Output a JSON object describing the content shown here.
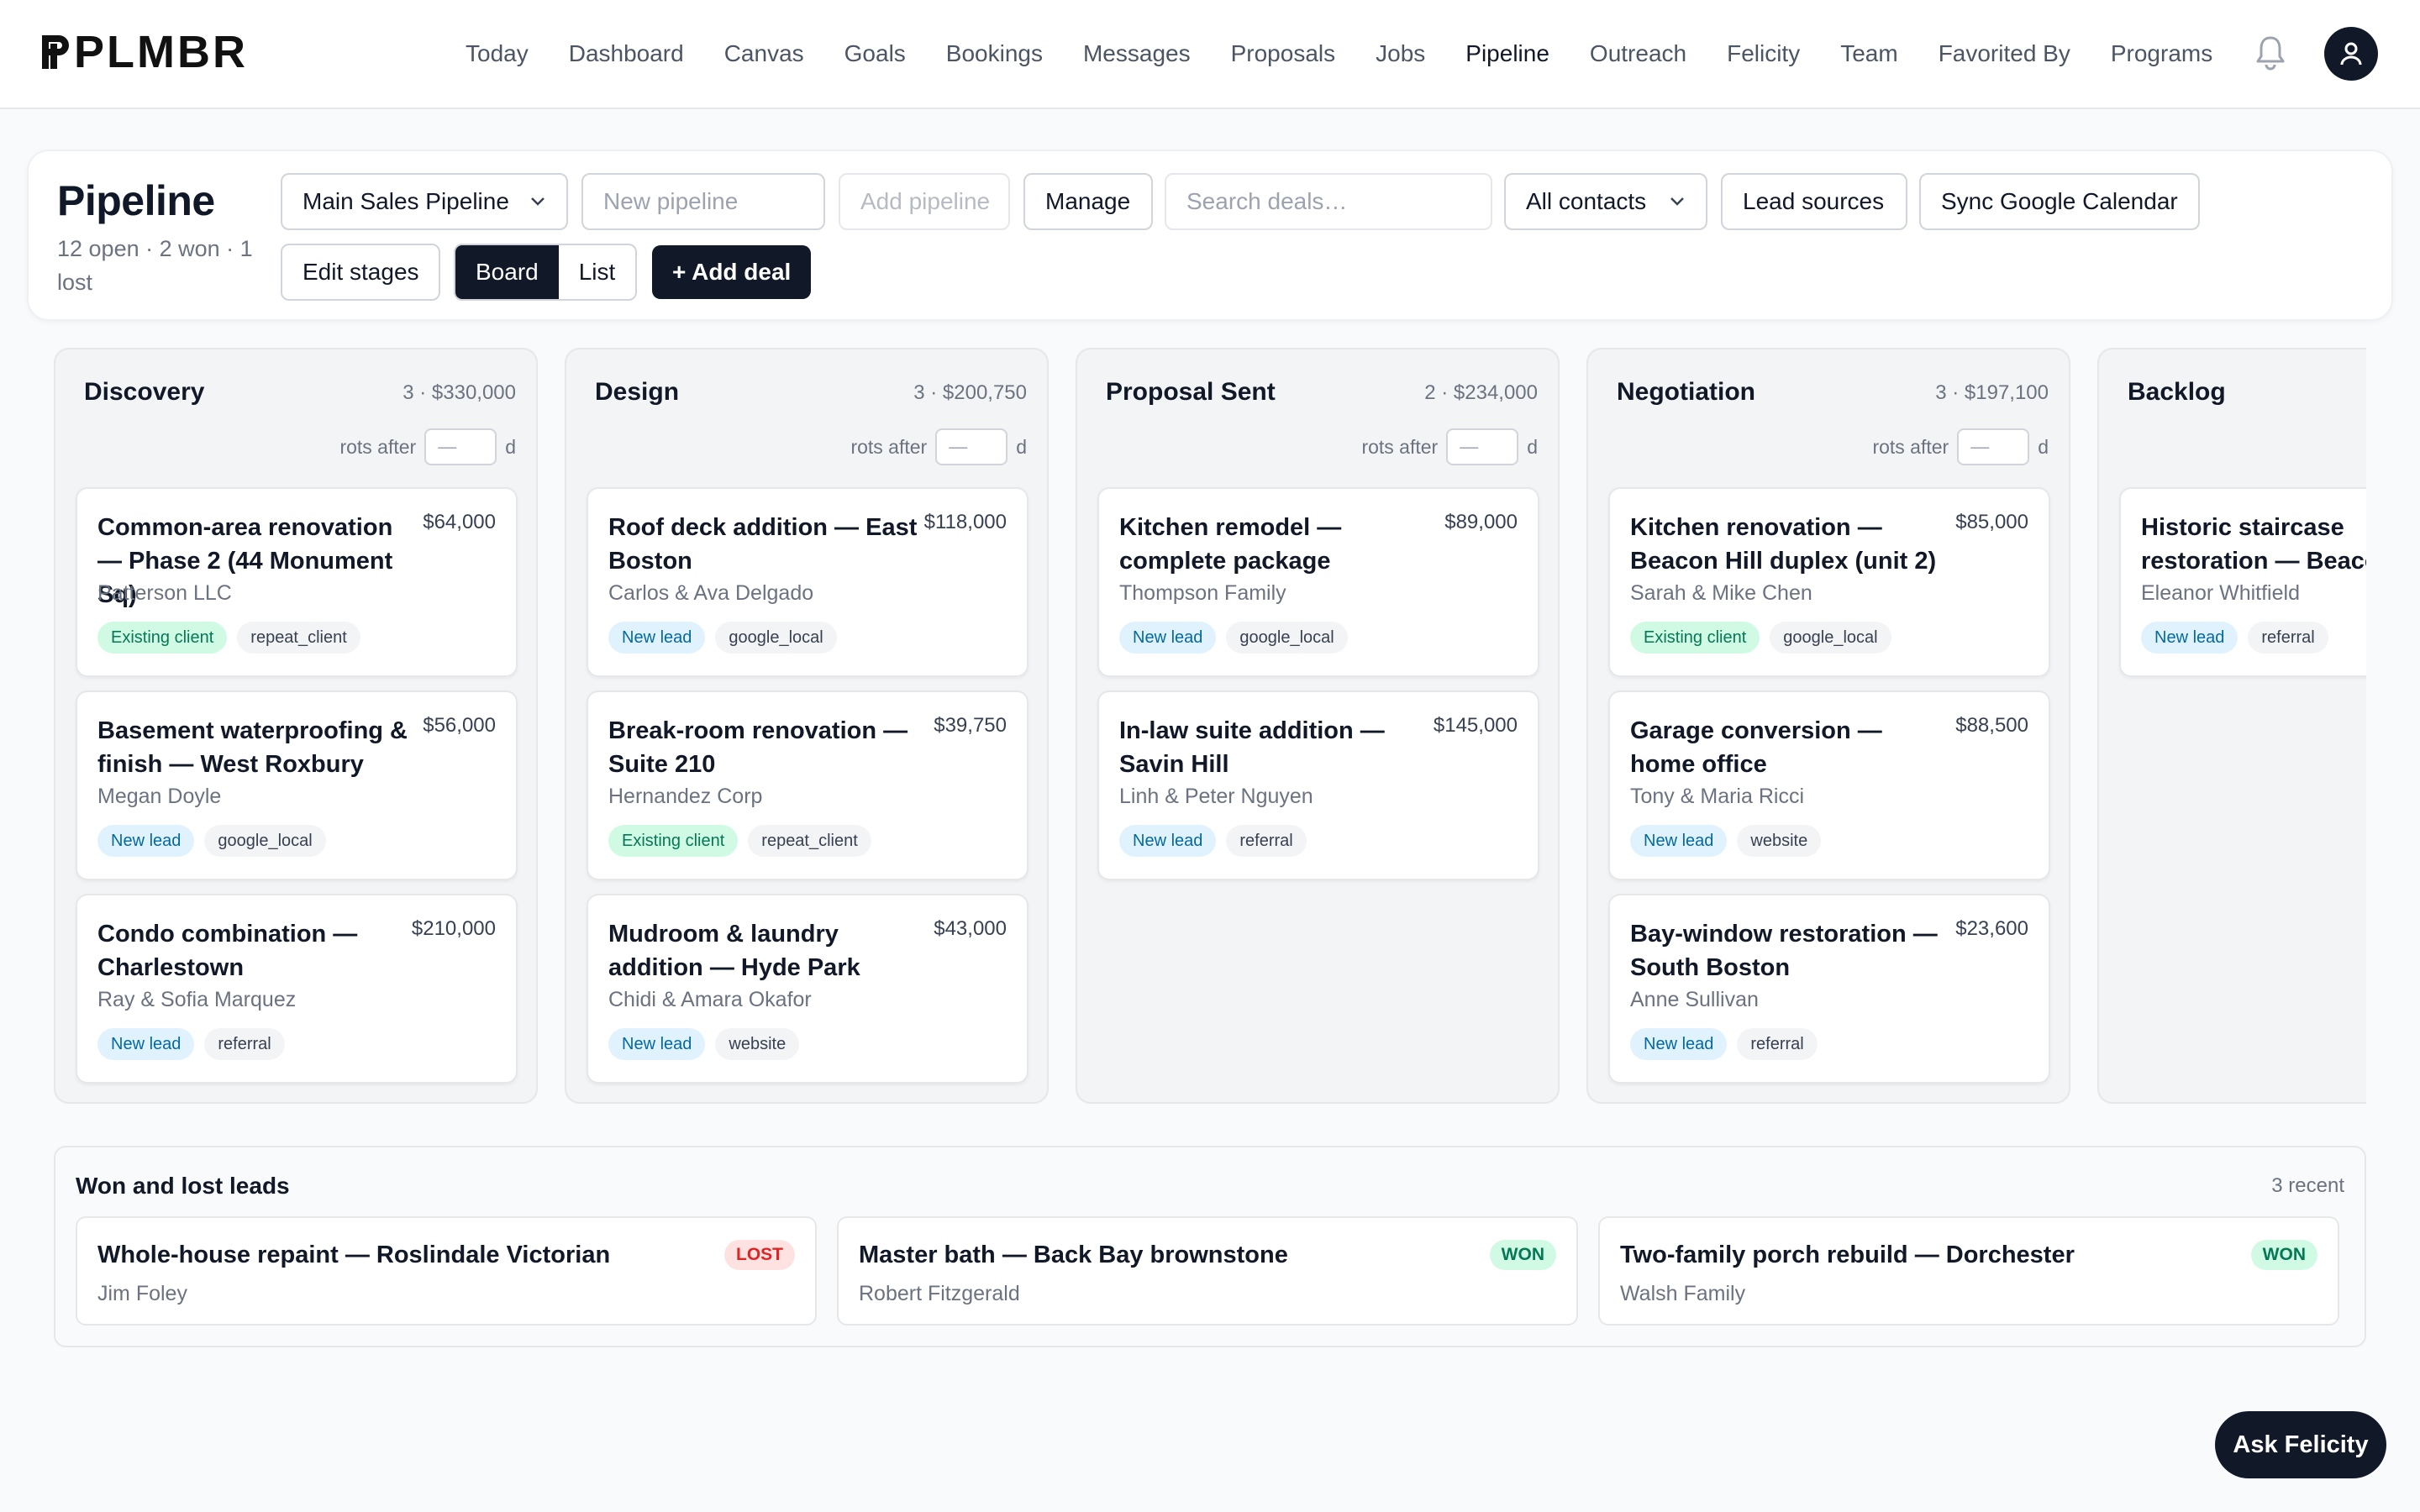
{
  "app": {
    "logo": "PLMBR"
  },
  "nav": {
    "items": [
      "Today",
      "Dashboard",
      "Canvas",
      "Goals",
      "Bookings",
      "Messages",
      "Proposals",
      "Jobs",
      "Pipeline",
      "Outreach",
      "Felicity",
      "Team",
      "Favorited By",
      "Programs"
    ],
    "active": "Pipeline"
  },
  "header": {
    "title": "Pipeline",
    "subtitle": "12 open · 2 won · 1 lost",
    "pipeline_select": "Main Sales Pipeline",
    "new_pipeline_placeholder": "New pipeline",
    "add_pipeline": "Add pipeline",
    "manage": "Manage",
    "search_placeholder": "Search deals…",
    "contacts_select": "All contacts",
    "lead_sources": "Lead sources",
    "sync": "Sync Google Calendar",
    "edit_stages": "Edit stages",
    "view_board": "Board",
    "view_list": "List",
    "add_deal": "+ Add deal"
  },
  "board": {
    "rots_label": "rots after",
    "rots_placeholder": "—",
    "rots_unit": "d",
    "columns": [
      {
        "name": "Discovery",
        "meta": "3 · $330,000",
        "deals": [
          {
            "title": "Common-area renovation — Phase 2 (44 Monument Sq)",
            "amount": "$64,000",
            "contact": "Patterson LLC",
            "status": "Existing client",
            "source": "repeat_client"
          },
          {
            "title": "Basement waterproofing & finish — West Roxbury",
            "amount": "$56,000",
            "contact": "Megan Doyle",
            "status": "New lead",
            "source": "google_local"
          },
          {
            "title": "Condo combination — Charlestown",
            "amount": "$210,000",
            "contact": "Ray & Sofia Marquez",
            "status": "New lead",
            "source": "referral"
          }
        ]
      },
      {
        "name": "Design",
        "meta": "3 · $200,750",
        "deals": [
          {
            "title": "Roof deck addition — East Boston",
            "amount": "$118,000",
            "contact": "Carlos & Ava Delgado",
            "status": "New lead",
            "source": "google_local"
          },
          {
            "title": "Break-room renovation — Suite 210",
            "amount": "$39,750",
            "contact": "Hernandez Corp",
            "status": "Existing client",
            "source": "repeat_client"
          },
          {
            "title": "Mudroom & laundry addition — Hyde Park",
            "amount": "$43,000",
            "contact": "Chidi & Amara Okafor",
            "status": "New lead",
            "source": "website"
          }
        ]
      },
      {
        "name": "Proposal Sent",
        "meta": "2 · $234,000",
        "deals": [
          {
            "title": "Kitchen remodel — complete package",
            "amount": "$89,000",
            "contact": "Thompson Family",
            "status": "New lead",
            "source": "google_local"
          },
          {
            "title": "In-law suite addition — Savin Hill",
            "amount": "$145,000",
            "contact": "Linh & Peter Nguyen",
            "status": "New lead",
            "source": "referral"
          }
        ]
      },
      {
        "name": "Negotiation",
        "meta": "3 · $197,100",
        "deals": [
          {
            "title": "Kitchen renovation — Beacon Hill duplex (unit 2)",
            "amount": "$85,000",
            "contact": "Sarah & Mike Chen",
            "status": "Existing client",
            "source": "google_local"
          },
          {
            "title": "Garage conversion — home office",
            "amount": "$88,500",
            "contact": "Tony & Maria Ricci",
            "status": "New lead",
            "source": "website"
          },
          {
            "title": "Bay-window restoration — South Boston",
            "amount": "$23,600",
            "contact": "Anne Sullivan",
            "status": "New lead",
            "source": "referral"
          }
        ]
      },
      {
        "name": "Backlog",
        "meta": "",
        "deals": [
          {
            "title": "Historic staircase restoration — Beacon Hill",
            "amount": "",
            "contact": "Eleanor Whitfield",
            "status": "New lead",
            "source": "referral"
          }
        ]
      }
    ]
  },
  "won_lost": {
    "title": "Won and lost leads",
    "count": "3 recent",
    "items": [
      {
        "title": "Whole-house repaint — Roslindale Victorian",
        "contact": "Jim Foley",
        "badge": "LOST"
      },
      {
        "title": "Master bath — Back Bay brownstone",
        "contact": "Robert Fitzgerald",
        "badge": "WON"
      },
      {
        "title": "Two-family porch rebuild — Dorchester",
        "contact": "Walsh Family",
        "badge": "WON"
      }
    ]
  },
  "assistant": {
    "label": "Ask Felicity"
  },
  "colors": {
    "primary": "#111827",
    "new_lead_bg": "#e0f2fe",
    "existing_bg": "#d1fae5",
    "lost": "#dc2626",
    "won": "#047857"
  }
}
